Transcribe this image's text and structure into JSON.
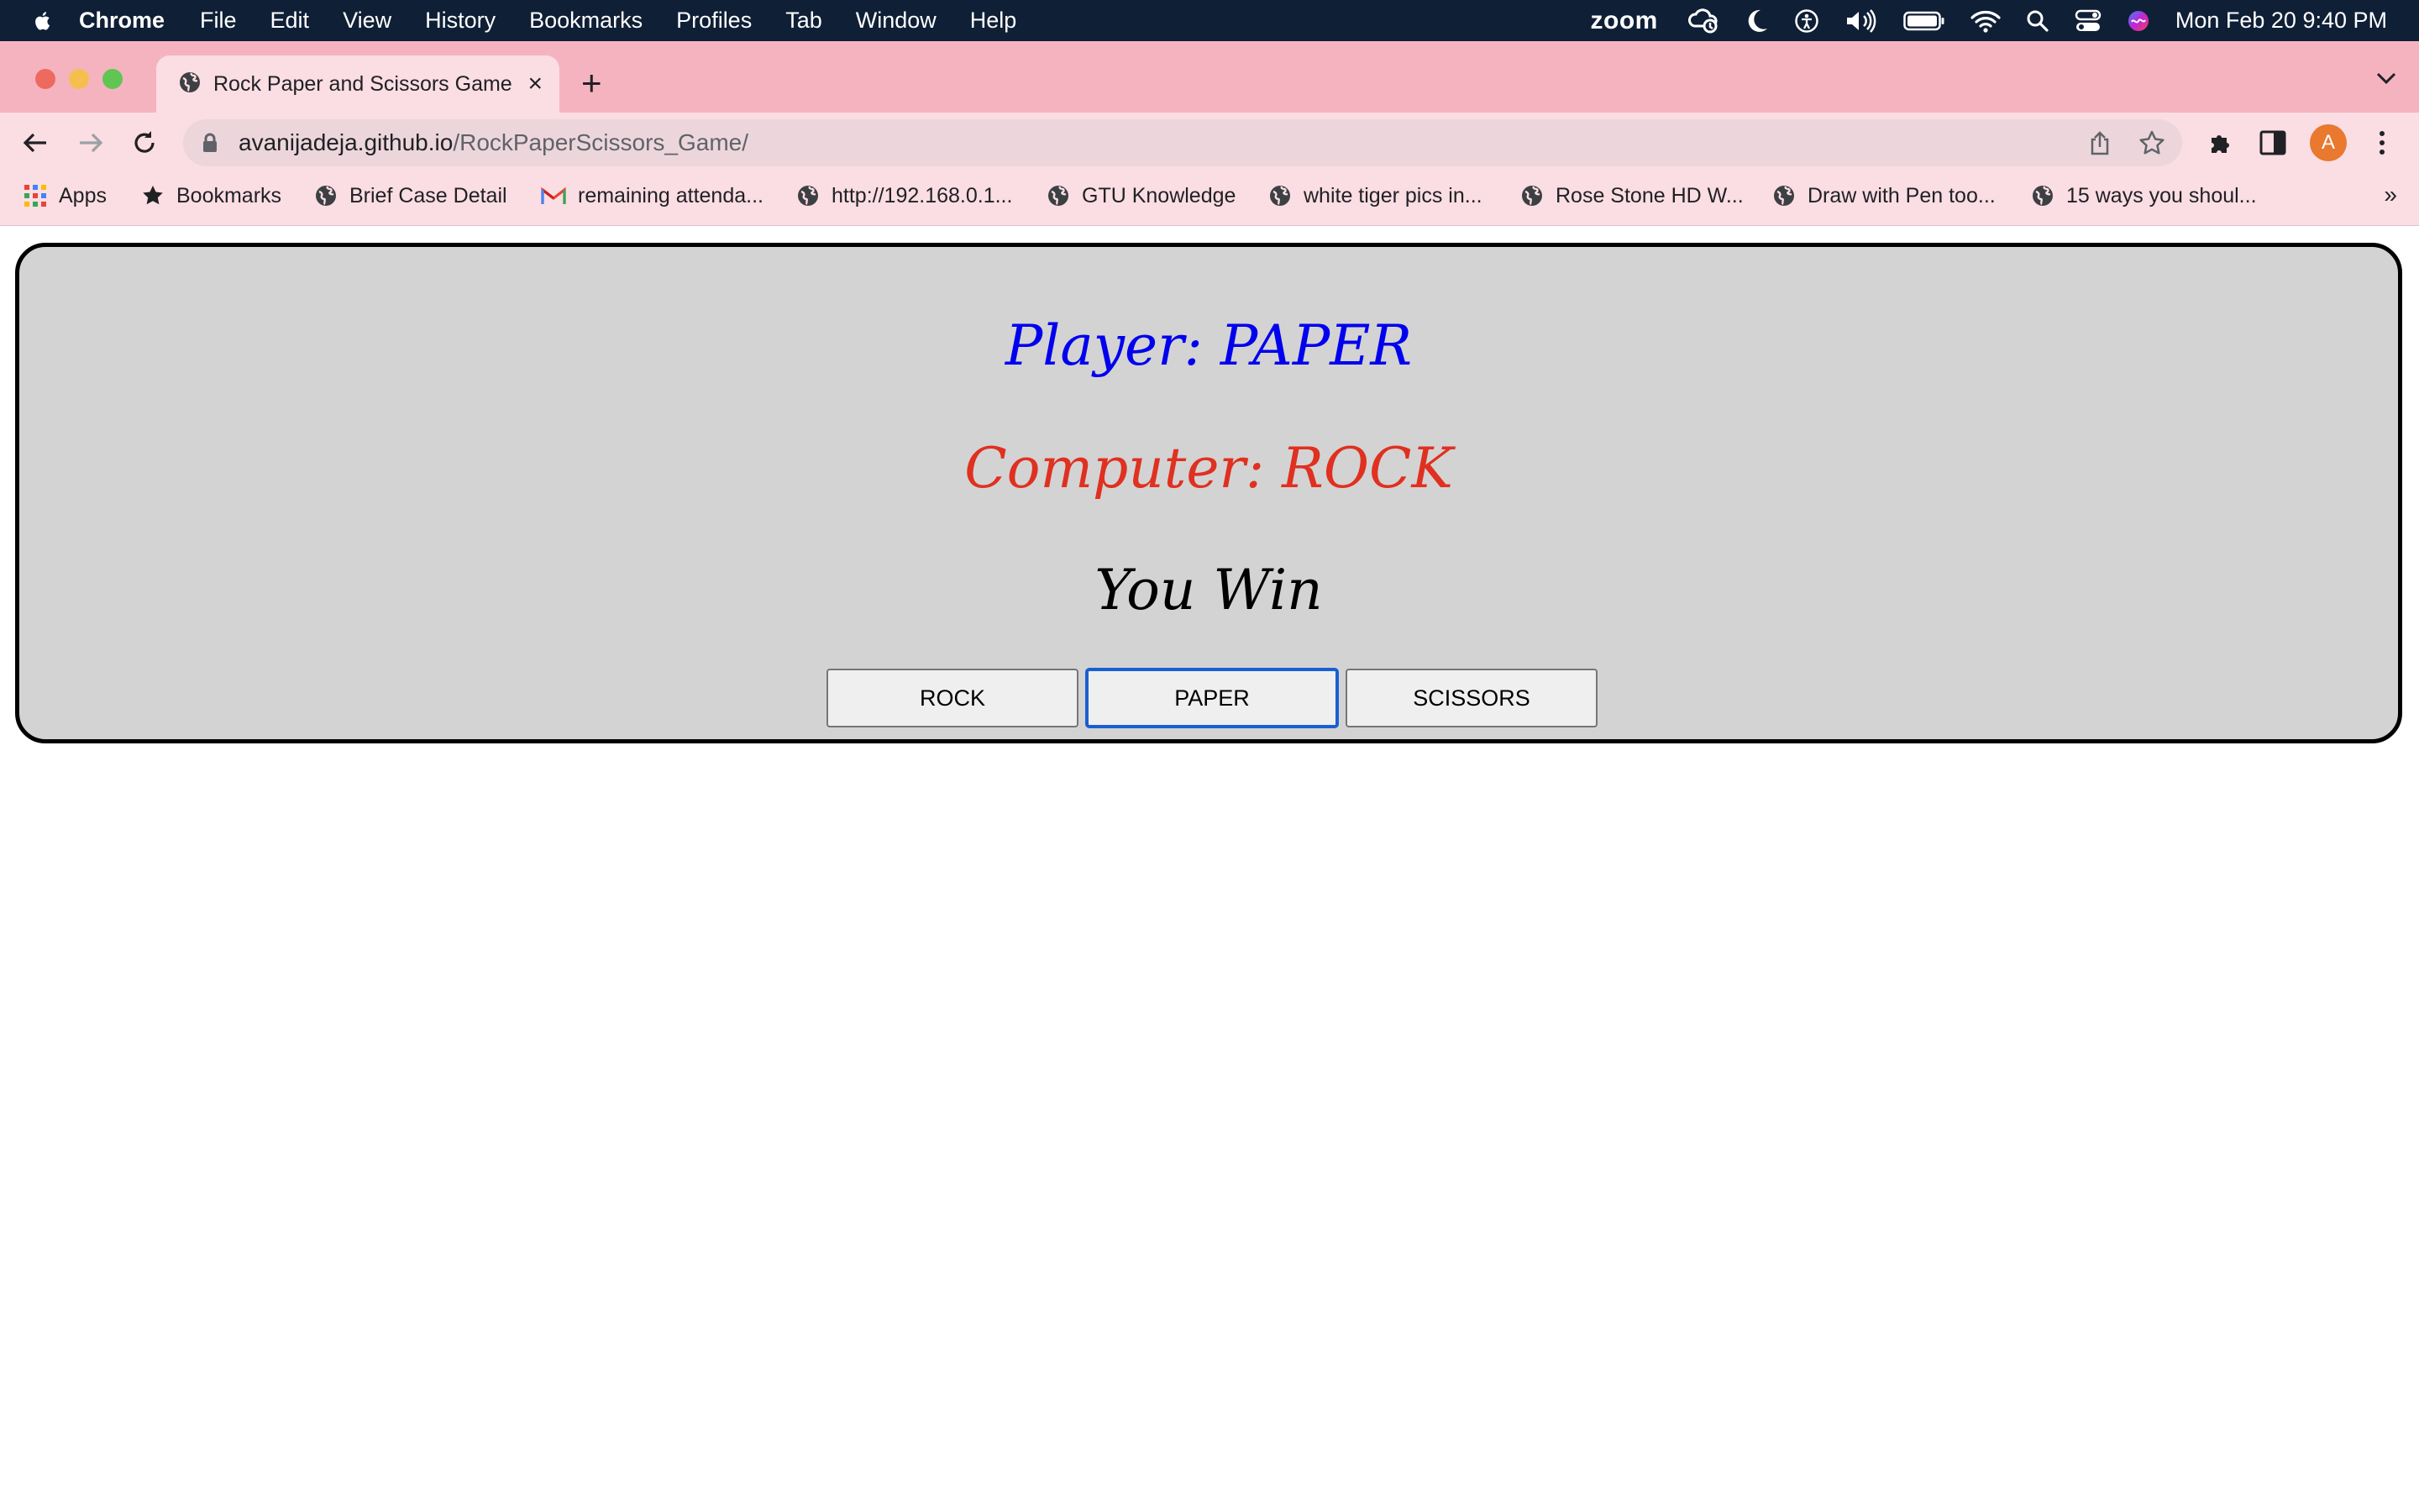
{
  "menubar": {
    "app_name": "Chrome",
    "menus": [
      "File",
      "Edit",
      "View",
      "History",
      "Bookmarks",
      "Profiles",
      "Tab",
      "Window",
      "Help"
    ],
    "status_icons": [
      "zoom-icon",
      "cloud-status-icon",
      "moon-icon",
      "accessibility-icon",
      "volume-icon",
      "battery-icon",
      "wifi-icon",
      "spotlight-search-icon",
      "control-center-icon",
      "siri-icon"
    ],
    "zoom_label": "zoom",
    "clock": "Mon Feb 20  9:40 PM"
  },
  "browser": {
    "tab_title": "Rock Paper and Scissors Game",
    "new_tab_label": "+",
    "url_host": "avanijadeja.github.io",
    "url_path": "/RockPaperScissors_Game/",
    "profile_initial": "A",
    "profile_color": "#e8792f",
    "tab_strip_color": "#f5b3c0",
    "toolbar_color": "#fbdde4"
  },
  "bookmarks": [
    {
      "label": "Apps",
      "icon": "apps-grid-icon"
    },
    {
      "label": "Bookmarks",
      "icon": "star-icon"
    },
    {
      "label": "Brief Case Detail",
      "icon": "globe-icon"
    },
    {
      "label": "remaining attenda...",
      "icon": "gmail-icon"
    },
    {
      "label": "http://192.168.0.1...",
      "icon": "globe-icon"
    },
    {
      "label": "GTU Knowledge",
      "icon": "globe-icon"
    },
    {
      "label": "white tiger pics in...",
      "icon": "globe-icon"
    },
    {
      "label": "Rose Stone HD W...",
      "icon": "globe-icon"
    },
    {
      "label": "Draw with Pen too...",
      "icon": "globe-icon"
    },
    {
      "label": "15 ways you shoul...",
      "icon": "globe-icon"
    }
  ],
  "bookmarks_overflow": "»",
  "game": {
    "player_text": "Player: PAPER",
    "computer_text": "Computer: ROCK",
    "result_text": "You Win",
    "buttons": [
      "ROCK",
      "PAPER",
      "SCISSORS"
    ],
    "focused_button": "PAPER",
    "player_color": "#0000ee",
    "computer_color": "#e03020",
    "panel_color": "#d3d3d3"
  }
}
